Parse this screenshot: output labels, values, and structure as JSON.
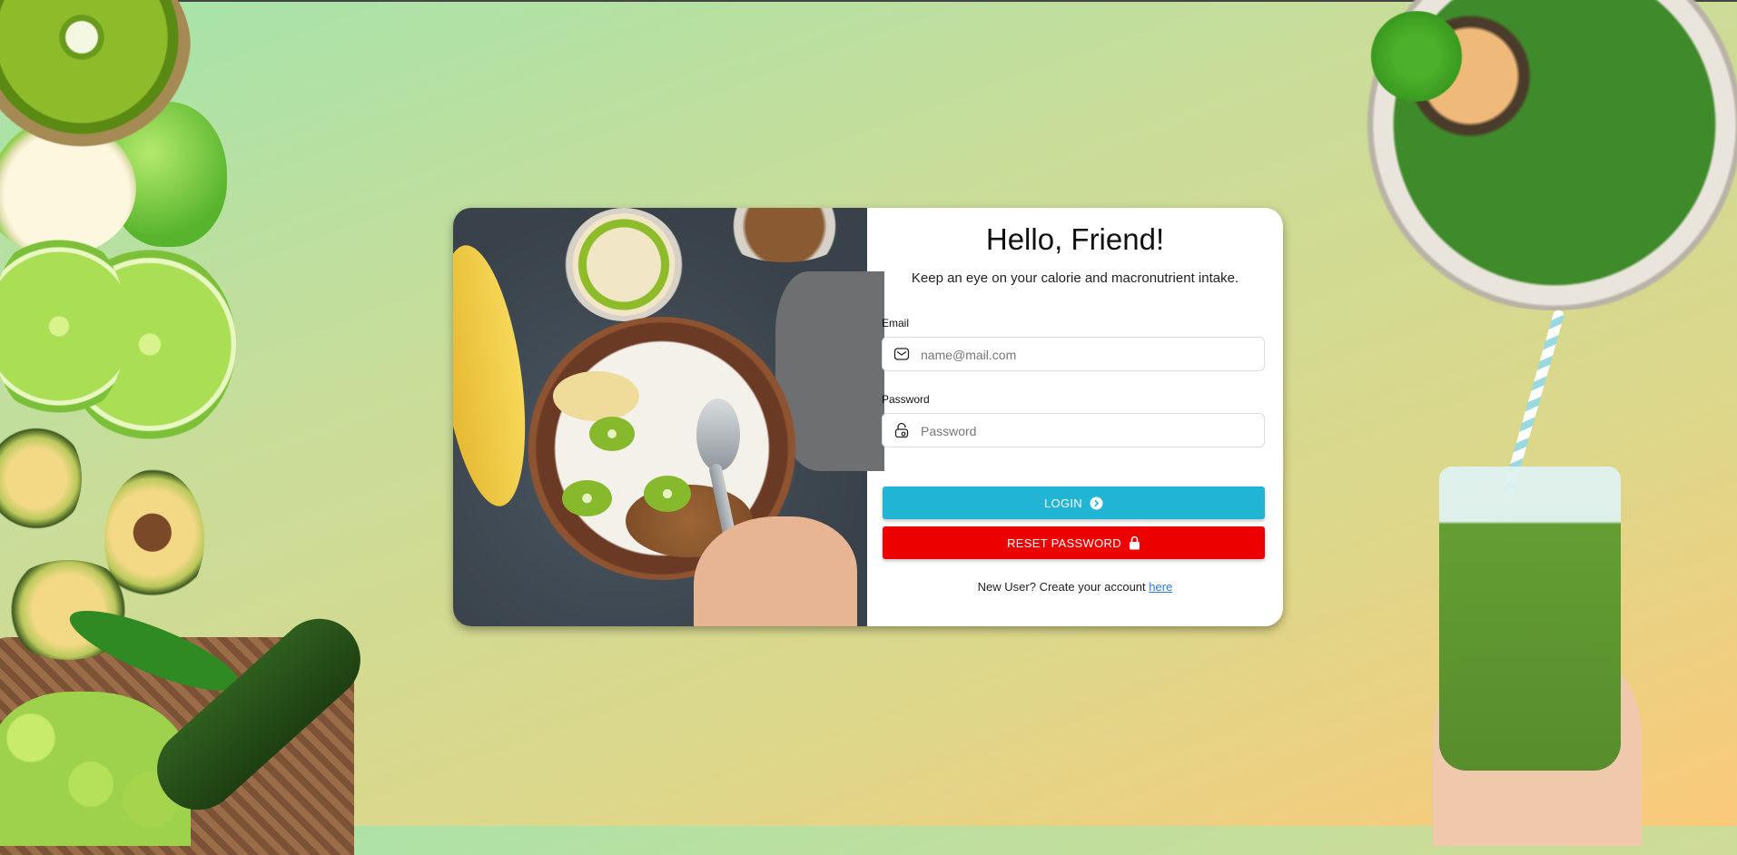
{
  "card": {
    "title": "Hello, Friend!",
    "subtitle": "Keep an eye on your calorie and macronutrient intake.",
    "email": {
      "label": "Email",
      "placeholder": "name@mail.com",
      "value": ""
    },
    "password": {
      "label": "Password",
      "placeholder": "Password",
      "value": ""
    },
    "login_button": "LOGIN",
    "reset_button": "RESET PASSWORD",
    "signup_text": "New User? Create your account",
    "signup_link": "here"
  },
  "colors": {
    "login": "#22b4d4",
    "reset": "#ec0000",
    "link": "#2a7be4",
    "background_start": "#a3e4ab",
    "background_end": "#fbc97a"
  },
  "icons": {
    "email": "envelope-icon",
    "password": "lock-key-icon",
    "login": "arrow-circle-right-icon",
    "reset": "padlock-icon"
  }
}
